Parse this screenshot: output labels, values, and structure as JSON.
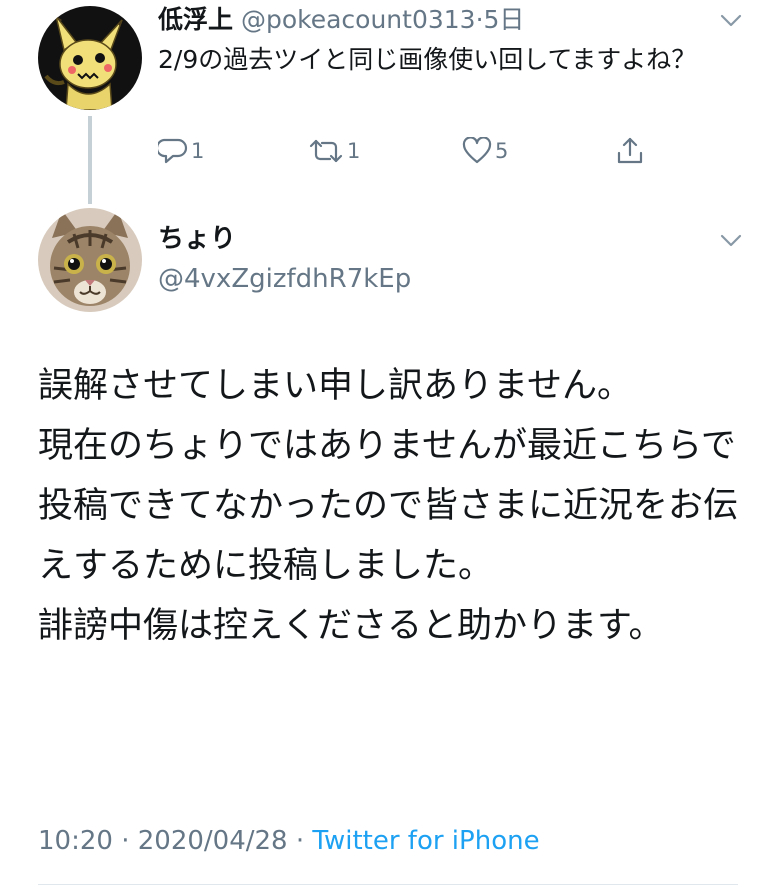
{
  "reply": {
    "name": "低浮上",
    "handle": "@pokeacount0313",
    "separator": "·",
    "time": "5日",
    "text": "2/9の過去ツイと同じ画像使い回してますよね？",
    "reply_count": "1",
    "retweet_count": "1",
    "like_count": "5",
    "avatar_icon": "mimikyu-avatar"
  },
  "tweet": {
    "name": "ちょり",
    "handle": "@4vxZgizfdhR7kEp",
    "text": "誤解させてしまい申し訳ありません。\n現在のちょりではありませんが最近こちらで投稿できてなかったので皆さまに近況をお伝えするために投稿しました。\n誹謗中傷は控えくださると助かります。",
    "time": "10:20",
    "separator": "·",
    "date": "2020/04/28",
    "source": "Twitter for iPhone",
    "avatar_icon": "cat-avatar"
  },
  "colors": {
    "text": "#14171a",
    "muted": "#657786",
    "link": "#1da1f2",
    "divider": "#e1e8ed"
  }
}
